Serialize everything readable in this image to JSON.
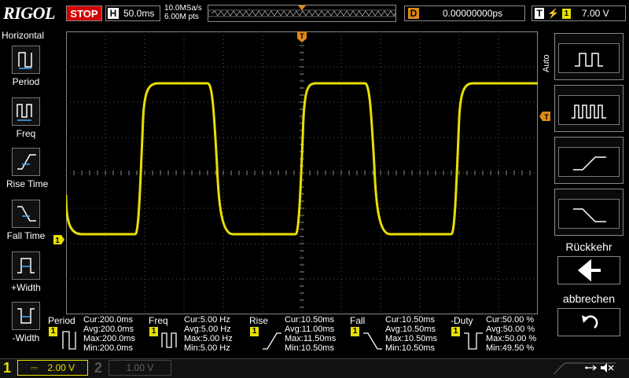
{
  "top": {
    "logo": "RIGOL",
    "run_state": "STOP",
    "h_label": "H",
    "timebase": "50.0ms",
    "sample_rate": "10.0MSa/s",
    "memory_depth": "6.00M pts",
    "delay_label": "D",
    "delay_value": "0.00000000ps",
    "trigger_label": "T",
    "trigger_channel": "1",
    "trigger_level": "7.00 V"
  },
  "left_panel": {
    "title": "Horizontal",
    "items": [
      {
        "label": "Period"
      },
      {
        "label": "Freq"
      },
      {
        "label": "Rise Time"
      },
      {
        "label": "Fall Time"
      },
      {
        "label": "+Width"
      },
      {
        "label": "-Width"
      }
    ]
  },
  "right_panel": {
    "auto_label": "Auto",
    "back_label": "Rückkehr",
    "cancel_label": "abbrechen"
  },
  "markers": {
    "trigger_pos": "T",
    "ch1_ground": "1",
    "trigger_level": "T"
  },
  "measurements": [
    {
      "name": "Period",
      "channel": "1",
      "cur": "Cur:200.0ms",
      "avg": "Avg:200.0ms",
      "max": "Max:200.0ms",
      "min": "Min:200.0ms"
    },
    {
      "name": "Freq",
      "channel": "1",
      "cur": "Cur:5.00 Hz",
      "avg": "Avg:5.00 Hz",
      "max": "Max:5.00 Hz",
      "min": "Min:5.00 Hz"
    },
    {
      "name": "Rise",
      "channel": "1",
      "cur": "Cur:10.50ms",
      "avg": "Avg:11.00ms",
      "max": "Max:11.50ms",
      "min": "Min:10.50ms"
    },
    {
      "name": "Fall",
      "channel": "1",
      "cur": "Cur:10.50ms",
      "avg": "Avg:10.50ms",
      "max": "Max:10.50ms",
      "min": "Min:10.50ms"
    },
    {
      "name": "-Duty",
      "channel": "1",
      "cur": "Cur:50.00 %",
      "avg": "Avg:50.00 %",
      "max": "Max:50.00 %",
      "min": "Min:49.50 %"
    }
  ],
  "channels": [
    {
      "number": "1",
      "scale": "2.00 V"
    },
    {
      "number": "2",
      "scale": "1.00 V"
    }
  ],
  "colors": {
    "ch1": "#e8e000",
    "trigger": "#e08a16",
    "stop": "#d40000"
  }
}
